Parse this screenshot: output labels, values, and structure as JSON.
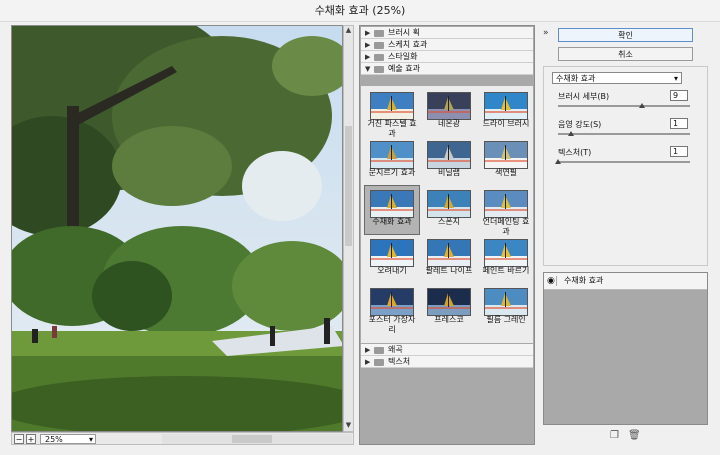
{
  "window": {
    "title": "수채화 효과 (25%)"
  },
  "preview": {
    "zoom": "25%"
  },
  "categories_top": [
    {
      "label": "브러시 획",
      "expanded": false
    },
    {
      "label": "스케치 효과",
      "expanded": false
    },
    {
      "label": "스타일화",
      "expanded": false
    },
    {
      "label": "예술 효과",
      "expanded": true
    }
  ],
  "categories_bottom": [
    {
      "label": "왜곡",
      "expanded": false
    },
    {
      "label": "텍스처",
      "expanded": false
    }
  ],
  "thumbnails": [
    {
      "label": "거친 파스텔 효과",
      "selected": false
    },
    {
      "label": "네온광",
      "selected": false
    },
    {
      "label": "드라이 브러시",
      "selected": false
    },
    {
      "label": "문지르기 효과",
      "selected": false
    },
    {
      "label": "비닐랩",
      "selected": false
    },
    {
      "label": "색연필",
      "selected": false
    },
    {
      "label": "수채화 효과",
      "selected": true
    },
    {
      "label": "스폰지",
      "selected": false
    },
    {
      "label": "언더페인팅 효과",
      "selected": false
    },
    {
      "label": "오려내기",
      "selected": false
    },
    {
      "label": "팔레트 나이프",
      "selected": false
    },
    {
      "label": "페인트 바르기",
      "selected": false
    },
    {
      "label": "포스터 가장자리",
      "selected": false
    },
    {
      "label": "프레스코",
      "selected": false
    },
    {
      "label": "필름 그레인",
      "selected": false
    }
  ],
  "buttons": {
    "ok": "확인",
    "cancel": "취소"
  },
  "settings": {
    "filter_selected": "수채화 효과",
    "params": [
      {
        "label": "브러시 세부(B)",
        "value": "9",
        "fraction": 0.64
      },
      {
        "label": "음영 강도(S)",
        "value": "1",
        "fraction": 0.1
      },
      {
        "label": "텍스처(T)",
        "value": "1",
        "fraction": 0.0
      }
    ]
  },
  "layers": [
    {
      "label": "수채화 효과"
    }
  ],
  "icons": {
    "collapse": "double-chevron-up-icon",
    "visibility": "eye-icon",
    "new_layer": "new-layer-icon",
    "delete": "trash-icon"
  }
}
